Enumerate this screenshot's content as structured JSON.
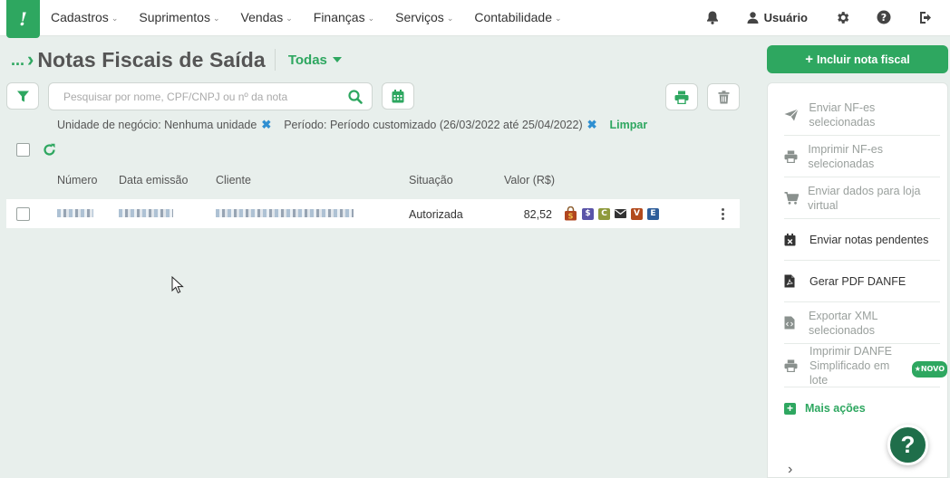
{
  "app": {
    "logo_glyph": "!"
  },
  "nav": {
    "items": [
      {
        "label": "Cadastros"
      },
      {
        "label": "Suprimentos"
      },
      {
        "label": "Vendas"
      },
      {
        "label": "Finanças"
      },
      {
        "label": "Serviços"
      },
      {
        "label": "Contabilidade"
      }
    ],
    "user_label": "Usuário"
  },
  "header": {
    "breadcrumb": "...",
    "title": "Notas Fiscais de Saída",
    "filter_label": "Todas"
  },
  "search": {
    "placeholder": "Pesquisar por nome, CPF/CNPJ ou nº da nota"
  },
  "chips": [
    {
      "label": "Unidade de negócio: Nenhuma unidade"
    },
    {
      "label": "Período: Período customizado (26/03/2022 até 25/04/2022)"
    }
  ],
  "clear_label": "Limpar",
  "table": {
    "columns": {
      "numero": "Número",
      "data": "Data emissão",
      "cliente": "Cliente",
      "situacao": "Situação",
      "valor": "Valor (R$)"
    },
    "rows": [
      {
        "situacao": "Autorizada",
        "valor": "82,52",
        "badges": [
          "$",
          "C",
          "V",
          "E"
        ]
      }
    ]
  },
  "panel": {
    "primary_label": "Incluir nota fiscal",
    "actions": [
      {
        "label": "Enviar NF-es selecionadas",
        "enabled": false
      },
      {
        "label": "Imprimir NF-es selecionadas",
        "enabled": false
      },
      {
        "label": "Enviar dados para loja virtual",
        "enabled": false
      },
      {
        "label": "Enviar notas pendentes",
        "enabled": true
      },
      {
        "label": "Gerar PDF DANFE",
        "enabled": true
      },
      {
        "label": "Exportar XML selecionados",
        "enabled": false
      },
      {
        "label": "Imprimir DANFE Simplificado em lote",
        "enabled": false,
        "badge": "NOVO"
      }
    ],
    "more_label": "Mais ações",
    "help_glyph": "?"
  },
  "colors": {
    "brand": "#2ea760",
    "brand_dark": "#1f6e4a",
    "link_x": "#2f8fd1"
  }
}
